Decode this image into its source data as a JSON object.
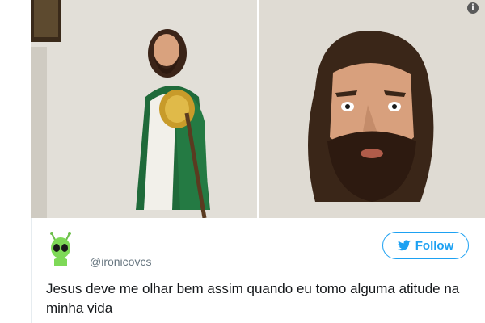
{
  "photos": [
    {
      "name": "statue-full-body"
    },
    {
      "name": "statue-face-closeup"
    }
  ],
  "tweet": {
    "handle": "@ironicovcs",
    "follow_label": "Follow",
    "text": "Jesus deve me olhar bem assim quando eu tomo alguma atitude na minha vida"
  },
  "icons": {
    "info": "info-icon",
    "avatar": "alien-icon",
    "follow": "twitter-bird-icon"
  },
  "colors": {
    "accent": "#1da1f2",
    "handle": "#66757f",
    "text": "#14171a"
  }
}
